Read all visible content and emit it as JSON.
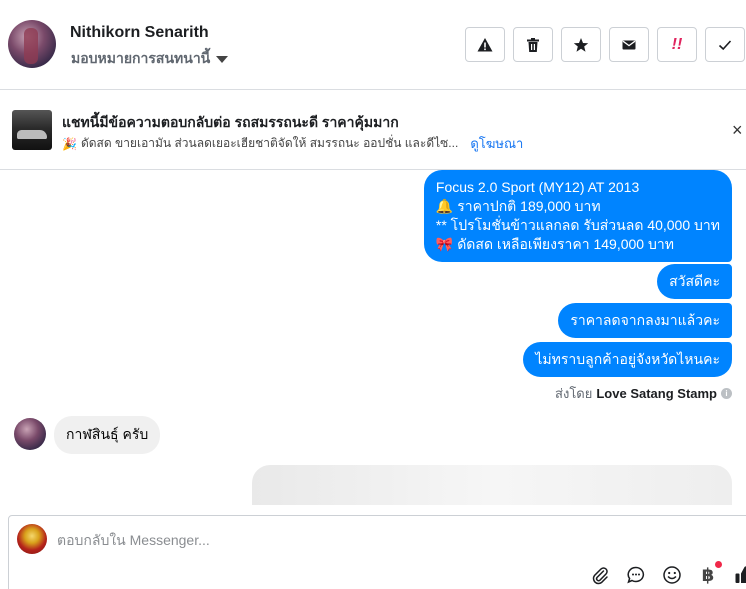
{
  "header": {
    "name": "Nithikorn Senarith",
    "assign_label": "มอบหมายการสนทนานี้",
    "actions": [
      {
        "icon": "warning-icon",
        "label": ""
      },
      {
        "icon": "trash-icon",
        "label": ""
      },
      {
        "icon": "star-icon",
        "label": ""
      },
      {
        "icon": "mail-icon",
        "label": ""
      },
      {
        "icon": "double-exclamation-icon",
        "label": "!!"
      },
      {
        "icon": "check-icon",
        "label": ""
      }
    ],
    "accent_red": "#e0245e"
  },
  "ad": {
    "title": "แชทนี้มีข้อความตอบกลับต่อ รถสมรรถนะดี ราคาคุ้มมาก",
    "emoji": "🎉",
    "description": "ดัดสด ขายเอามัน ส่วนลดเยอะเฮียชาติจัดให้ สมรรถนะ ออปชั่น และดีไซ...",
    "link": "ดูโฆษณา",
    "close": "×"
  },
  "conversation": {
    "outgoing_color": "#0084ff",
    "messages_out": [
      {
        "lines": [
          "Focus 2.0 Sport (MY12) AT 2013",
          "🔔 ราคาปกติ 189,000 บาท",
          "** โปรโมชั่นข้าวแลกลด รับส่วนลด 40,000 บาท",
          "🎀 ดัดสด เหลือเพียงราคา 149,000 บาท"
        ]
      },
      {
        "text": "สวัสดีคะ"
      },
      {
        "text": "ราคาลดจากลงมาแล้วคะ"
      },
      {
        "text": "ไม่ทราบลูกค้าอยู่จังหวัดไหนคะ"
      }
    ],
    "sent_by_prefix": "ส่งโดย",
    "sent_by_name": "Love Satang Stamp",
    "info": "i",
    "message_in": "กาฬสินธุ์ ครับ"
  },
  "composer": {
    "placeholder": "ตอบกลับใน Messenger...",
    "tools": [
      "paperclip-icon",
      "chat-bubble-icon",
      "smile-icon",
      "baht-icon",
      "thumbs-up-icon"
    ],
    "baht_symbol": "฿"
  }
}
